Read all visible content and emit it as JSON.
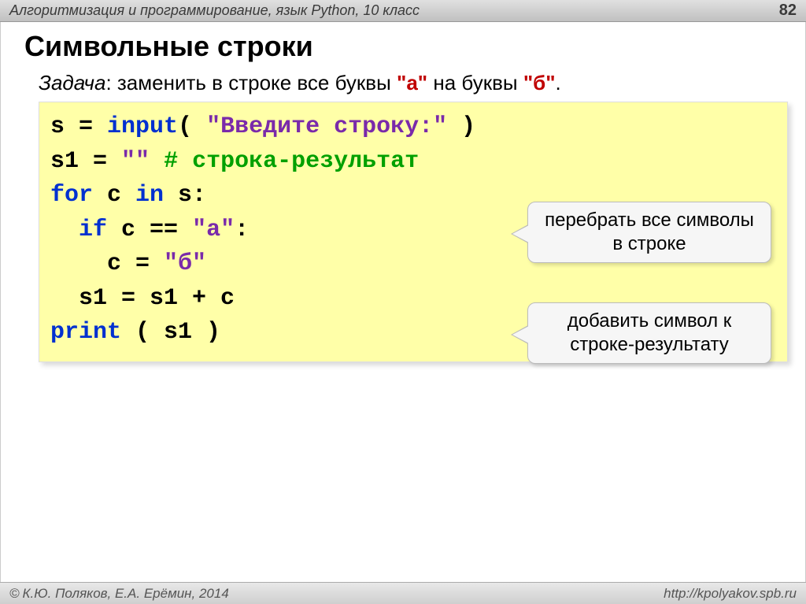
{
  "header": {
    "subject": "Алгоритмизация и программирование, язык Python, 10 класс",
    "page": "82"
  },
  "title": "Символьные строки",
  "task": {
    "label": "Задача",
    "before1": ": заменить в строке все буквы ",
    "letterA": "\"а\"",
    "mid": " на буквы ",
    "letterB": "\"б\"",
    "end": "."
  },
  "code": {
    "l1_s": "s",
    "l1_eq": " = ",
    "l1_input": "input",
    "l1_p1": "( ",
    "l1_str": "\"Введите строку:\"",
    "l1_p2": " )",
    "l2_s1": "s1",
    "l2_eq": " = ",
    "l2_str": "\"\"",
    "l2_sp": "    ",
    "l2_cmt": "# строка-результат",
    "l3_for": "for",
    "l3_c": " c ",
    "l3_in": "in",
    "l3_s": " s:",
    "l4_ind": "  ",
    "l4_if": "if",
    "l4_cond1": " c == ",
    "l4_stra": "\"а\"",
    "l4_colon": ":",
    "l5_ind": "    ",
    "l5_c": "c = ",
    "l5_strb": "\"б\"",
    "l6_ind": "  ",
    "l6_assign": "s1 = s1 + c",
    "l7_print": "print",
    "l7_args": " ( s1 )"
  },
  "callouts": {
    "c1": "перебрать все символы в строке",
    "c2": "добавить символ к строке-результату"
  },
  "footer": {
    "copyright": "К.Ю. Поляков, Е.А. Ерёмин, 2014",
    "url": "http://kpolyakov.spb.ru"
  }
}
